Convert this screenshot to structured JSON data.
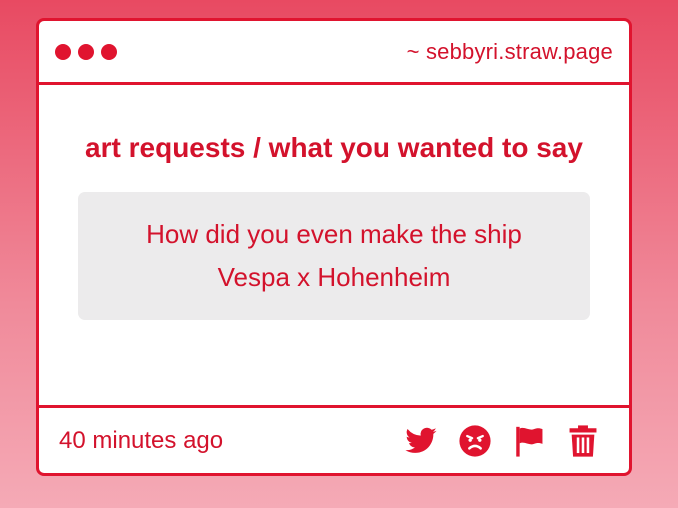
{
  "window": {
    "site": "~ sebbyri.straw.page"
  },
  "main": {
    "prompt": "art requests / what you wanted to say",
    "message": "How did you even make the ship Vespa x Hohenheim"
  },
  "footer": {
    "time": "40 minutes ago",
    "actions": [
      {
        "icon": "twitter-icon"
      },
      {
        "icon": "angry-face-icon"
      },
      {
        "icon": "flag-icon"
      },
      {
        "icon": "trash-icon"
      }
    ]
  },
  "colors": {
    "accent": "#e0142f",
    "text": "#d3122c",
    "message_bg": "#ecebec",
    "background_top": "#e84a62",
    "background_bottom": "#f5aab6"
  }
}
